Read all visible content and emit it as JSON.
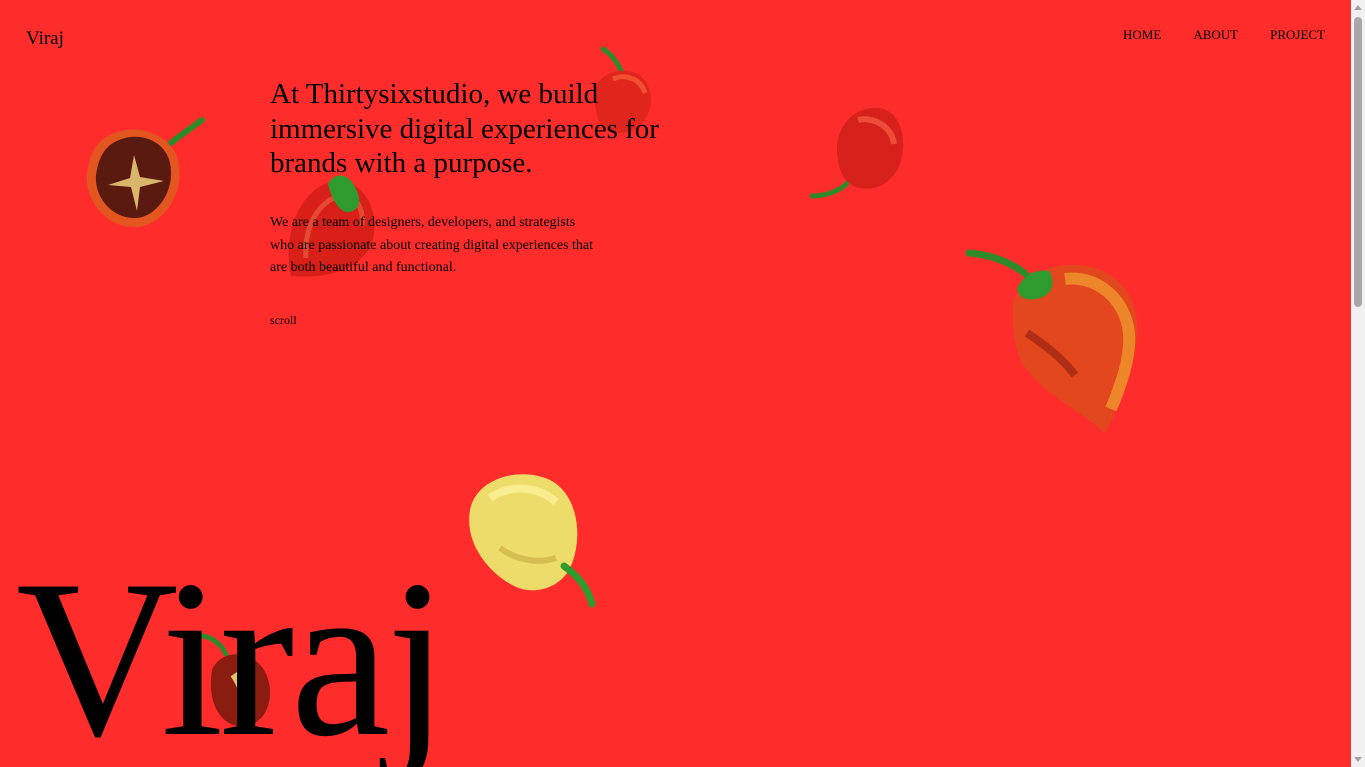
{
  "header": {
    "logo": "Viraj",
    "nav": [
      {
        "label": "HOME"
      },
      {
        "label": "ABOUT"
      },
      {
        "label": "PROJECT"
      }
    ]
  },
  "hero": {
    "headline": "At Thirtysixstudio, we build immersive digital experiences for brands with a purpose.",
    "intro": "We are a team of designers, developers, and strategists who are passionate about creating digital experiences that are both beautiful and functional.",
    "scroll": "scroll"
  },
  "footer_name": "Viraj",
  "theme": {
    "background": "#ff2c2c",
    "text": "#000000"
  }
}
